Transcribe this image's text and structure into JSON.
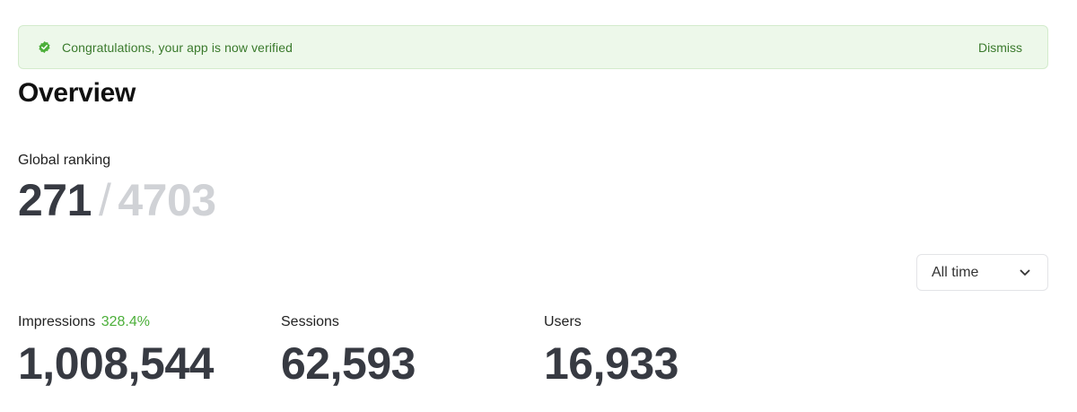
{
  "banner": {
    "icon": "verified-badge-icon",
    "message": "Congratulations, your app is now verified",
    "dismiss_label": "Dismiss",
    "accent_color": "#3a7a2c",
    "background_color": "#edf8ea"
  },
  "page": {
    "title": "Overview"
  },
  "ranking": {
    "label": "Global ranking",
    "current": "271",
    "separator": "/",
    "total": "4703"
  },
  "filter": {
    "selected": "All time",
    "icon": "chevron-down-icon"
  },
  "stats": [
    {
      "label": "Impressions",
      "change": "328.4%",
      "value": "1,008,544"
    },
    {
      "label": "Sessions",
      "value": "62,593"
    },
    {
      "label": "Users",
      "value": "16,933"
    }
  ],
  "colors": {
    "positive_change": "#4caf3a",
    "muted_number": "#d0d2d6",
    "primary_number": "#373a42"
  }
}
